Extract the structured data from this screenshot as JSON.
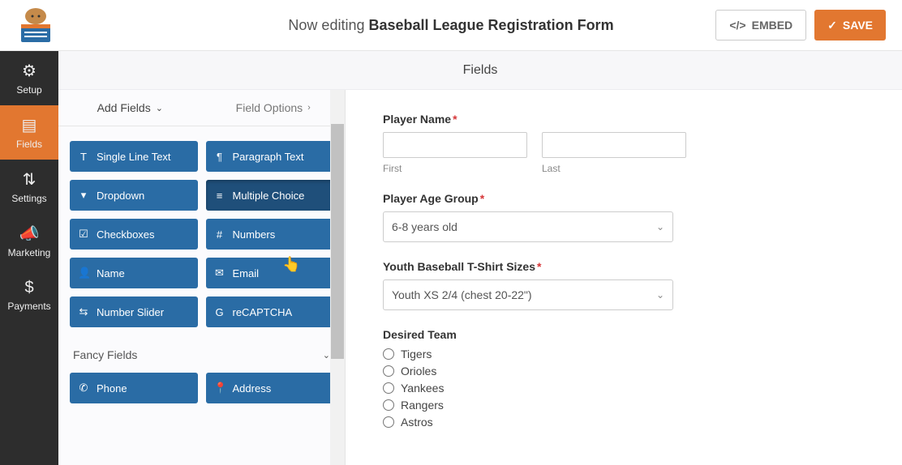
{
  "header": {
    "prefix": "Now editing",
    "title": "Baseball League Registration Form",
    "embed": "EMBED",
    "save": "SAVE"
  },
  "sidebar": [
    {
      "icon": "⚙",
      "label": "Setup"
    },
    {
      "icon": "▤",
      "label": "Fields"
    },
    {
      "icon": "⇅",
      "label": "Settings"
    },
    {
      "icon": "📣",
      "label": "Marketing"
    },
    {
      "icon": "$",
      "label": "Payments"
    }
  ],
  "section_title": "Fields",
  "tabs": {
    "add": "Add Fields",
    "options": "Field Options"
  },
  "standard_fields": [
    {
      "icon": "T",
      "label": "Single Line Text"
    },
    {
      "icon": "¶",
      "label": "Paragraph Text"
    },
    {
      "icon": "▾",
      "label": "Dropdown"
    },
    {
      "icon": "≡",
      "label": "Multiple Choice"
    },
    {
      "icon": "☑",
      "label": "Checkboxes"
    },
    {
      "icon": "#",
      "label": "Numbers"
    },
    {
      "icon": "👤",
      "label": "Name"
    },
    {
      "icon": "✉",
      "label": "Email"
    },
    {
      "icon": "⇆",
      "label": "Number Slider"
    },
    {
      "icon": "G",
      "label": "reCAPTCHA"
    }
  ],
  "fancy_header": "Fancy Fields",
  "fancy_fields": [
    {
      "icon": "✆",
      "label": "Phone"
    },
    {
      "icon": "📍",
      "label": "Address"
    }
  ],
  "form": {
    "player_name": {
      "label": "Player Name",
      "first": "First",
      "last": "Last"
    },
    "age_group": {
      "label": "Player Age Group",
      "value": "6-8 years old"
    },
    "shirt": {
      "label": "Youth Baseball T-Shirt Sizes",
      "value": "Youth XS  2/4 (chest 20-22\")"
    },
    "team": {
      "label": "Desired Team",
      "options": [
        "Tigers",
        "Orioles",
        "Yankees",
        "Rangers",
        "Astros"
      ]
    }
  }
}
